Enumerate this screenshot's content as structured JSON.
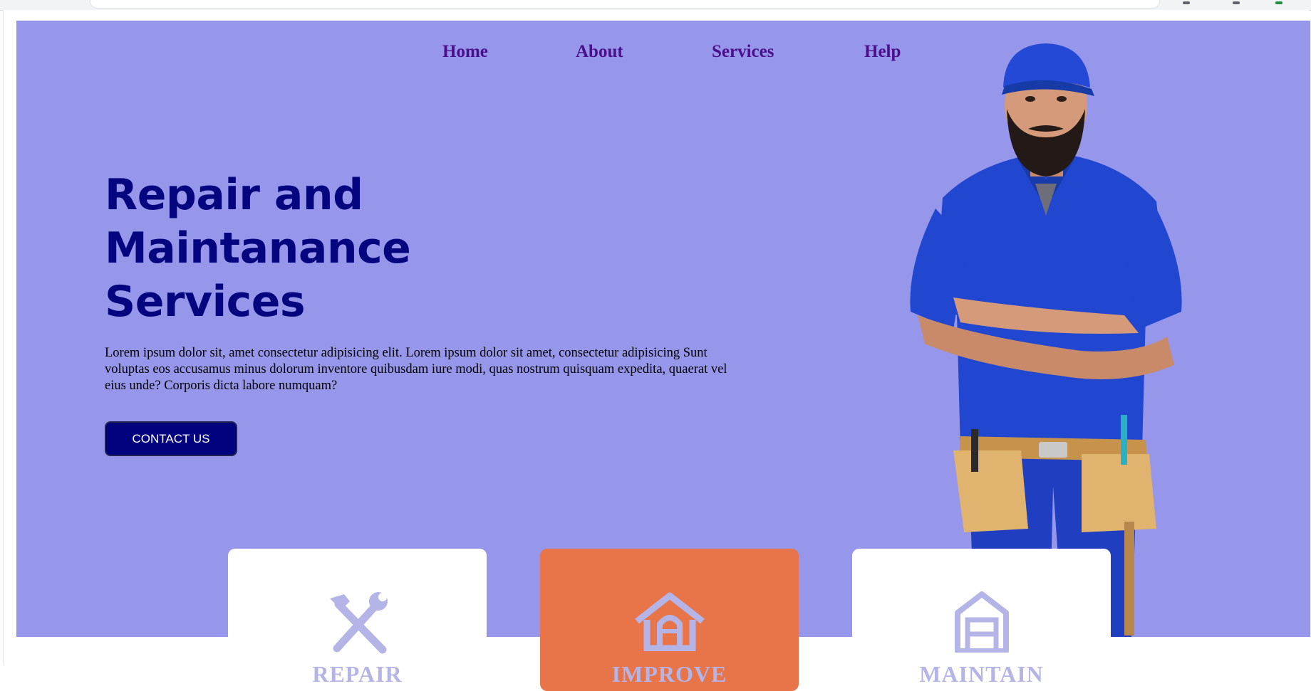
{
  "nav": {
    "items": [
      {
        "label": "Home"
      },
      {
        "label": "About"
      },
      {
        "label": "Services"
      },
      {
        "label": "Help"
      }
    ]
  },
  "hero": {
    "title": "Repair and Maintanance Services",
    "description": "Lorem ipsum dolor sit, amet consectetur adipisicing elit. Lorem ipsum dolor sit amet, consectetur adipisicing Sunt voluptas eos accusamus minus dolorum inventore quibusdam iure modi, quas nostrum quisquam expedita, quaerat vel eius unde? Corporis dicta labore numquam?",
    "cta_label": "CONTACT US",
    "image": "handyman-worker-photo"
  },
  "cards": [
    {
      "label": "REPAIR",
      "icon": "tools-icon",
      "style": "white"
    },
    {
      "label": "IMPROVE",
      "icon": "house-icon",
      "style": "orange"
    },
    {
      "label": "MAINTAIN",
      "icon": "garage-icon",
      "style": "white"
    }
  ],
  "colors": {
    "hero_bg": "#9696ea",
    "title": "#05057f",
    "nav_link": "#4b0f8c",
    "cta_bg": "#02027f",
    "accent_card": "#e8744a",
    "icon": "#b4b4e6"
  }
}
